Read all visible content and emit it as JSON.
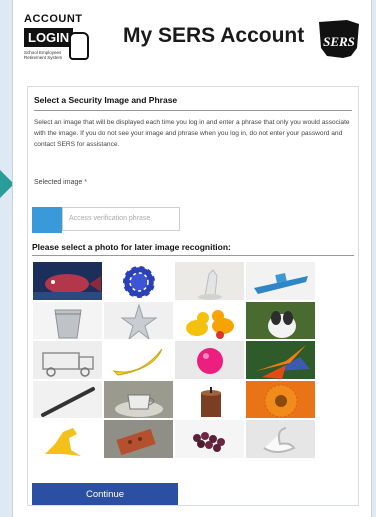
{
  "header": {
    "logo_line1": "ACCOUNT",
    "logo_line2": "LOGIN",
    "logo_small": "School Employees Retirement System",
    "title": "My SERS Account",
    "sers_logo_text": "SERS"
  },
  "security": {
    "section_title": "Select a Security Image and Phrase",
    "description": "Select an image that will be displayed each time you log in and enter a phrase that only you would associate with the image. If you do not see your image and phrase when you log in, do not enter your password and contact SERS for assistance.",
    "selected_image_label": "Selected image",
    "required_mark": "*",
    "phrase_placeholder": "Access verification phrase",
    "grid_title": "Please select a photo for later image recognition:",
    "photos": [
      "fish-photo",
      "poker-chip-photo",
      "glass-figurine-photo",
      "toy-boat-photo",
      "ice-bucket-photo",
      "starfish-photo",
      "rubber-ducks-photo",
      "dog-photo",
      "glass-truck-photo",
      "banana-photo",
      "pink-ball-photo",
      "bird-of-paradise-photo",
      "lighter-photo",
      "teacup-photo",
      "candle-photo",
      "orange-flower-photo",
      "toy-dinosaur-photo",
      "brick-photo",
      "grapes-photo",
      "swan-photo"
    ],
    "continue_label": "Continue"
  },
  "colors": {
    "accent": "#2a4fa3",
    "swatch": "#3a9ad9",
    "arrow": "#2a9d9a"
  }
}
